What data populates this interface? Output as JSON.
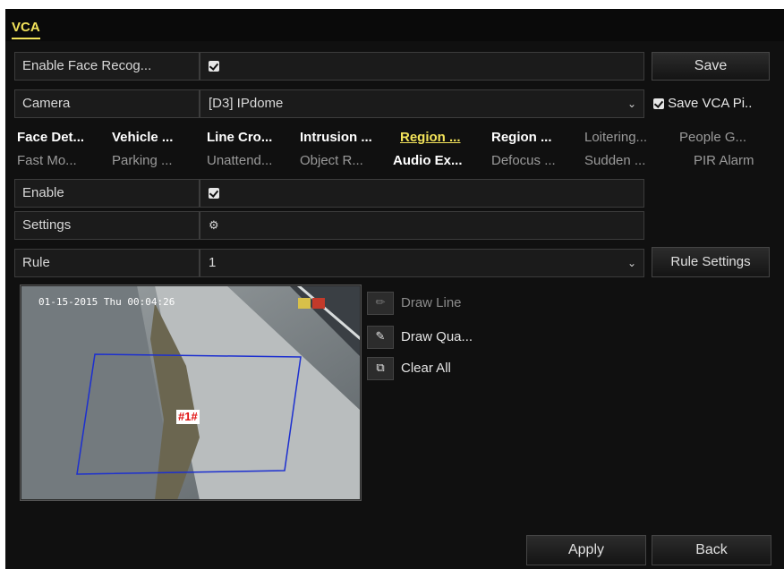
{
  "window": {
    "title": "VCA"
  },
  "face_recognition": {
    "label": "Enable Face Recog...",
    "checked": true
  },
  "save_button": "Save",
  "camera": {
    "label": "Camera",
    "value": "[D3] IPdome",
    "save_vca_label": "Save VCA Pi..",
    "save_vca_checked": true
  },
  "tabs_row1": [
    "Face Det...",
    "Vehicle ...",
    "Line Cro...",
    "Intrusion ...",
    "Region ...",
    "Region ...",
    "Loitering...",
    "People G..."
  ],
  "tabs_row2": [
    "Fast Mo...",
    "Parking ...",
    "Unattend...",
    "Object R...",
    "Audio Ex...",
    "Defocus ...",
    "Sudden ...",
    "PIR Alarm"
  ],
  "active_tab": "Region ...",
  "enable": {
    "label": "Enable",
    "checked": true
  },
  "settings": {
    "label": "Settings",
    "icon": "gear-icon"
  },
  "rule": {
    "label": "Rule",
    "value": "1",
    "settings_button": "Rule Settings"
  },
  "preview": {
    "osd_timestamp": "01-15-2015 Thu 00:04:26",
    "region_label": "#1#"
  },
  "tools": {
    "draw_line": "Draw Line",
    "draw_quad": "Draw Qua...",
    "clear_all": "Clear All"
  },
  "footer": {
    "apply": "Apply",
    "back": "Back"
  },
  "colors": {
    "accent": "#f3e35a",
    "region_border": "#1c2fd0",
    "region_label_bg": "#ffffff",
    "region_label_fg": "#e01010"
  }
}
